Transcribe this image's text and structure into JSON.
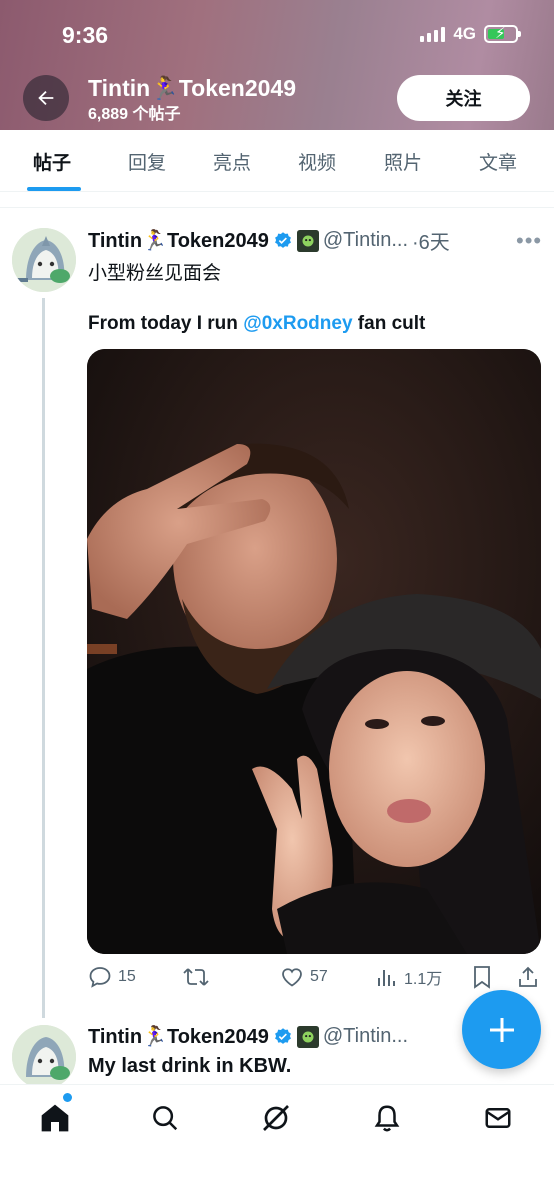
{
  "status_bar": {
    "time": "9:36",
    "network": "4G"
  },
  "header": {
    "profile_name": "Tintin🏃‍♀️Token2049",
    "post_count": "6,889 个帖子",
    "follow_label": "关注"
  },
  "tabs": [
    {
      "label": "帖子",
      "active": true
    },
    {
      "label": "回复"
    },
    {
      "label": "亮点"
    },
    {
      "label": "视频"
    },
    {
      "label": "照片"
    },
    {
      "label": "文章"
    }
  ],
  "tweet1": {
    "name": "Tintin🏃‍♀️Token2049",
    "handle": "@Tintin...",
    "time": "·6天",
    "text_line1": "小型粉丝见面会",
    "text_line2_prefix": "From today I run ",
    "mention": "@0xRodney",
    "text_line2_suffix": " fan cult",
    "replies": "15",
    "likes": "57",
    "views": "1.1万"
  },
  "tweet2": {
    "name": "Tintin🏃‍♀️Token2049",
    "handle": "@Tintin...",
    "text": "My last drink in KBW."
  },
  "colors": {
    "accent": "#1d9bf0",
    "verified": "#1d9bf0"
  }
}
